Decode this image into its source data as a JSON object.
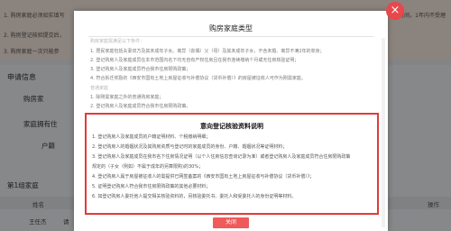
{
  "background": {
    "notice_lines": [
      "1. 购房家庭必须如实填写",
      "2. 购房登记核验提交后，",
      "3. 购房家庭一次只能参"
    ],
    "notice_right": "时间，1年内不受理",
    "section_title": "申请信息",
    "labels": [
      "购房家",
      "家庭拥有住",
      "户籍",
      "第1组家庭"
    ],
    "table_headers": [
      "姓名",
      "操作"
    ],
    "row_name": "王任杰",
    "row_action": "请"
  },
  "modal": {
    "title": "购房家庭类型",
    "requirements": [
      {
        "text": "购房家庭需满足以下条件：",
        "faded": true
      },
      {
        "text": "1. 居民家庭包括夫妻双方及其未成年子女。离异（丧偶）父（母）及其未成年子女，不含未婚、离异不满2年的单身；",
        "faded": false
      },
      {
        "text": "2. 登记购房人及家庭成员在本市范围内名下均无自有产权住房且在我市连续缴纳个月或无住房核验证明；",
        "faded": false
      },
      {
        "text": "3. 登记购房人及家庭成员符合我市住房限购政策；",
        "faded": false
      },
      {
        "text": "4. 符合拆迁奖励的《西安市国有土地上房屋征收与补偿协议（货币补偿）》的房屋被征收人可作为刚需家庭。",
        "faded": false
      },
      {
        "text": "普通家庭",
        "faded": true
      },
      {
        "text": "1. 除刚需家庭之外的普通购房家庭；",
        "faded": false
      },
      {
        "text": "2. 登记购房人及家庭成员符合我市住房限购政策。",
        "faded": false
      }
    ],
    "notes_title": "意向登记核验资料说明",
    "notes": [
      "1. 登记购房人及家庭成员的户籍证明材料、个税缴纳明细；",
      "2. 登记购房人的婚姻状况及其购房资质与登记时的家庭成员的身份、户籍、婚姻状况等证明材料；",
      "3. 登记购房人及家庭成员在我市名下住房情况证明（以个人住房信息查询记录为准）或者登记购房人及家庭成员符合住房限购政策",
      "   规定的（子女（例如）不属于成年的另算限购)的30%；",
      "4. 登记购房人属于房屋被征收人的需提供已网签备案的《西安市国有土地上房屋征收与补偿协议（货币补偿）》；",
      "5. 证明登记购房人符合我市住房限购政策的其他必要材料；",
      "6. 如登记购房人委托他人提交相关核验资料的，另核验委托书、委托人和受委托人的身份证明等材料。"
    ],
    "close_label": "关闭"
  },
  "close_x": "×",
  "colors": {
    "accent": "#e03c37",
    "button": "#ef5a5a",
    "overlay": "rgba(0,0,0,0.45)"
  }
}
